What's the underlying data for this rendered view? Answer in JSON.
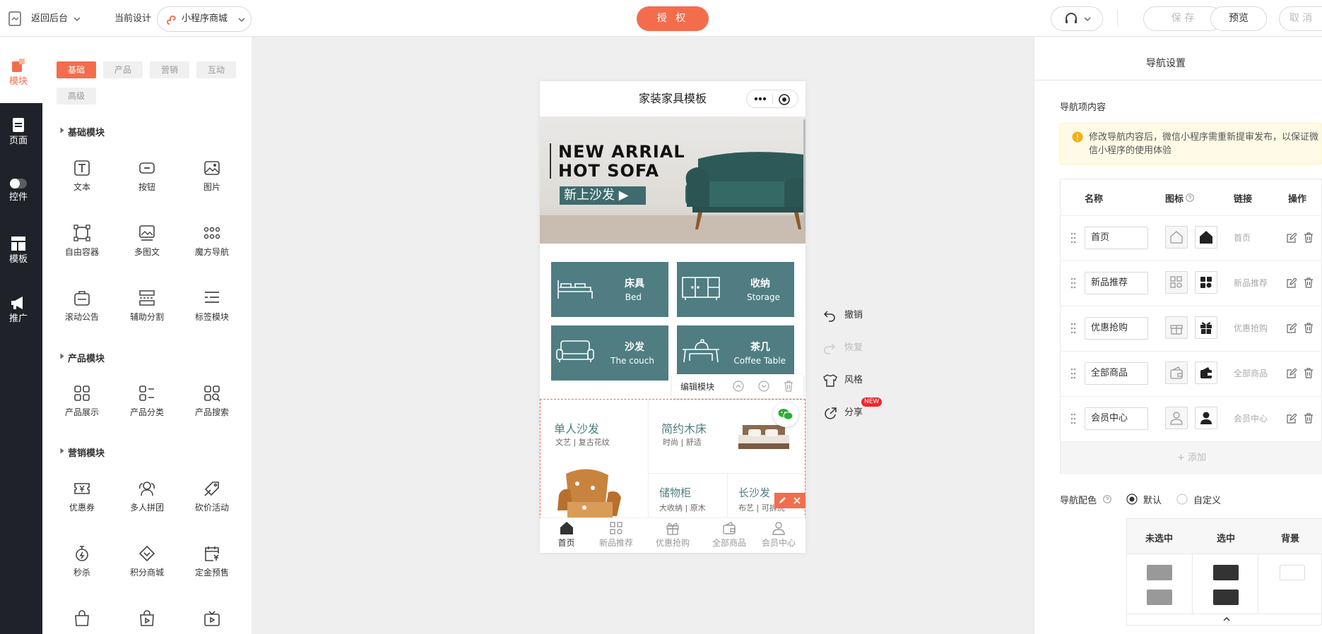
{
  "topbar": {
    "back_label": "返回后台",
    "current_design_label": "当前设计",
    "design_name": "小程序商城",
    "authorize_label": "授 权",
    "save_label": "保 存",
    "preview_label": "预览",
    "cancel_label": "取 消"
  },
  "rail": [
    {
      "label": "模块",
      "icon": "module-icon",
      "active": true
    },
    {
      "label": "页面",
      "icon": "page-icon"
    },
    {
      "label": "控件",
      "icon": "toggle-icon"
    },
    {
      "label": "模板",
      "icon": "template-icon"
    },
    {
      "label": "推广",
      "icon": "megaphone-icon"
    }
  ],
  "categories": [
    "基础",
    "产品",
    "营销",
    "互动",
    "高级"
  ],
  "sections": [
    {
      "title": "基础模块",
      "items": [
        "文本",
        "按钮",
        "图片",
        "自由容器",
        "多图文",
        "魔方导航",
        "滚动公告",
        "辅助分割",
        "标签模块"
      ]
    },
    {
      "title": "产品模块",
      "items": [
        "产品展示",
        "产品分类",
        "产品搜索"
      ]
    },
    {
      "title": "营销模块",
      "items": [
        "优惠券",
        "多人拼团",
        "砍价活动",
        "秒杀",
        "积分商城",
        "定金预售"
      ]
    }
  ],
  "phone": {
    "title": "家装家具模板",
    "banner": {
      "line1": "NEW ARRIAL",
      "line2": "HOT SOFA",
      "cn": "新上沙发"
    },
    "tiles": [
      {
        "cn": "床具",
        "en": "Bed"
      },
      {
        "cn": "收纳",
        "en": "Storage"
      },
      {
        "cn": "沙发",
        "en": "The couch"
      },
      {
        "cn": "茶几",
        "en": "Coffee Table"
      }
    ],
    "edit_module_label": "编辑模块",
    "products": [
      {
        "title": "单人沙发",
        "sub": "文艺 | 复古花纹"
      },
      {
        "title": "简约木床",
        "sub": "时尚 | 舒适"
      },
      {
        "title": "储物柜",
        "sub": "大收纳 | 原木"
      },
      {
        "title": "长沙发",
        "sub": "布艺 | 可拆洗"
      }
    ],
    "tabs": [
      "首页",
      "新品推荐",
      "优惠抢购",
      "全部商品",
      "会员中心"
    ]
  },
  "tools": {
    "undo": "撤销",
    "redo": "恢复",
    "style": "风格",
    "share": "分享",
    "share_badge": "NEW"
  },
  "right": {
    "panel_title": "导航设置",
    "section_title": "导航项内容",
    "notice": "修改导航内容后，微信小程序需重新提审发布，以保证微信小程序的使用体验",
    "headers": {
      "name": "名称",
      "icon": "图标",
      "link": "链接",
      "action": "操作"
    },
    "rows": [
      {
        "name": "首页",
        "link": "首页"
      },
      {
        "name": "新品推荐",
        "link": "新品推荐"
      },
      {
        "name": "优惠抢购",
        "link": "优惠抢购"
      },
      {
        "name": "全部商品",
        "link": "全部商品"
      },
      {
        "name": "会员中心",
        "link": "会员中心"
      }
    ],
    "add_label": "+ 添加",
    "color_label": "导航配色",
    "color_options": [
      "默认",
      "自定义"
    ],
    "color_headers": [
      "未选中",
      "选中",
      "背景"
    ],
    "colors": {
      "unselected": "#999999",
      "selected": "#333333",
      "background": "#ffffff",
      "accent": "#f36d4d",
      "tile": "#4f7d82"
    }
  }
}
